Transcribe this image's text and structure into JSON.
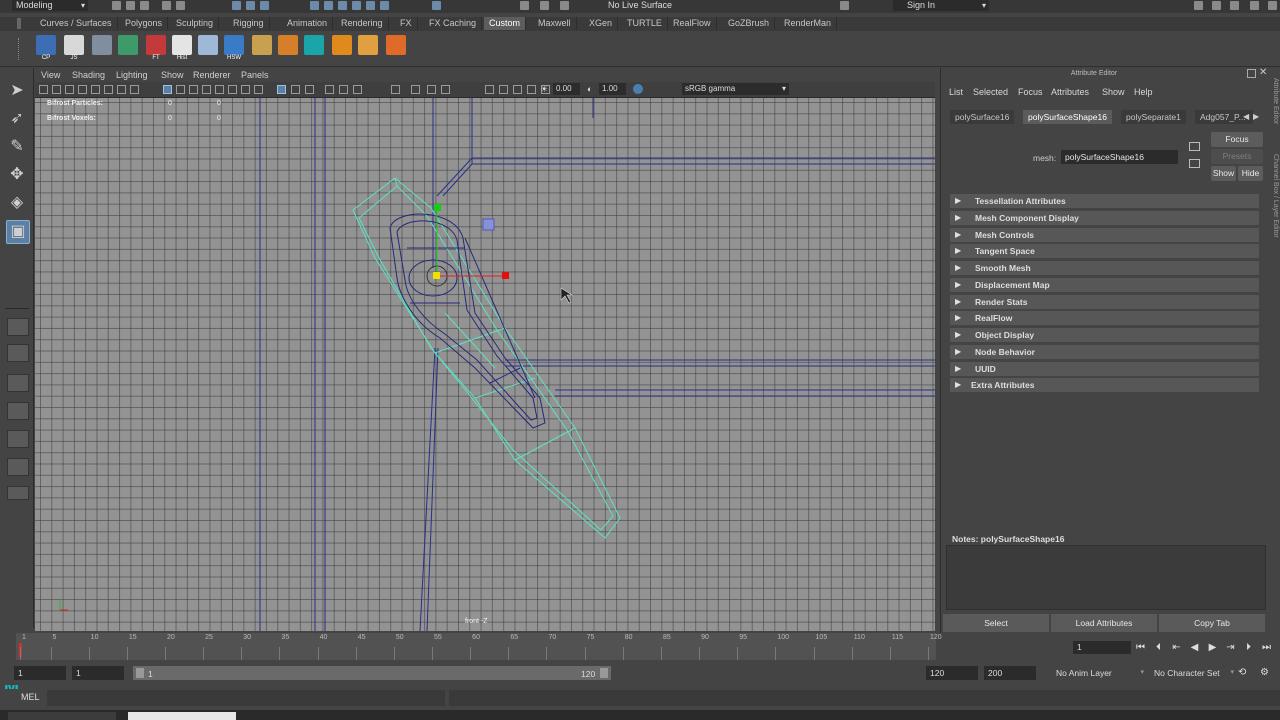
{
  "app": {
    "mode": "Modeling",
    "live_surface": "No Live Surface",
    "sign_in": "Sign In"
  },
  "shelf": {
    "tabs": [
      "Curves / Surfaces",
      "Polygons",
      "Sculpting",
      "Rigging",
      "Animation",
      "Rendering",
      "FX",
      "FX Caching",
      "Custom",
      "Maxwell",
      "XGen",
      "TURTLE",
      "RealFlow",
      "GoZBrush",
      "RenderMan"
    ],
    "active_tab": "Custom",
    "icons": [
      {
        "name": "cp",
        "label": "CP",
        "color": "#3d6db5"
      },
      {
        "name": "js",
        "label": "JS",
        "color": "#d8d8d8"
      },
      {
        "name": "joint-tool",
        "label": "",
        "color": "#7f8fa0"
      },
      {
        "name": "checker",
        "label": "",
        "color": "#3f9a6a"
      },
      {
        "name": "ft",
        "label": "FT",
        "color": "#c43a3a"
      },
      {
        "name": "hist",
        "label": "Hist",
        "color": "#e4e4e4"
      },
      {
        "name": "scatter",
        "label": "",
        "color": "#a0b8d8"
      },
      {
        "name": "hsw",
        "label": "HSW",
        "color": "#3a7bc8"
      },
      {
        "name": "pen",
        "label": "",
        "color": "#c8a050"
      },
      {
        "name": "box",
        "label": "",
        "color": "#d67e2a"
      },
      {
        "name": "teal",
        "label": "",
        "color": "#1aa6a8"
      },
      {
        "name": "gear",
        "label": "",
        "color": "#e08a1e"
      },
      {
        "name": "diamond",
        "label": "",
        "color": "#e0a040"
      },
      {
        "name": "cube-arrow",
        "label": "",
        "color": "#e06a2a"
      }
    ]
  },
  "viewport": {
    "menus": [
      "View",
      "Shading",
      "Lighting",
      "Show",
      "Renderer",
      "Panels"
    ],
    "exposure": "0.00",
    "gamma": "1.00",
    "color_space": "sRGB gamma",
    "hud": [
      {
        "label": "Bifrost Particles:",
        "a": "0",
        "b": "0"
      },
      {
        "label": "Bifrost Voxels:",
        "a": "0",
        "b": "0"
      }
    ],
    "camera": "front -Z"
  },
  "attribute_editor": {
    "title": "Attribute Editor",
    "menus": [
      "List",
      "Selected",
      "Focus",
      "Attributes",
      "Show",
      "Help"
    ],
    "tabs": [
      "polySurface16",
      "polySurfaceShape16",
      "polySeparate1",
      "Adg057_P..."
    ],
    "active_tab": "polySurfaceShape16",
    "focus_button": "Focus",
    "presets_button": "Presets",
    "show_button": "Show",
    "hide_button": "Hide",
    "mesh_label": "mesh:",
    "mesh_value": "polySurfaceShape16",
    "sections": [
      "Tessellation Attributes",
      "Mesh Component Display",
      "Mesh Controls",
      "Tangent Space",
      "Smooth Mesh",
      "Displacement Map",
      "Render Stats",
      "RealFlow",
      "Object Display",
      "Node Behavior",
      "UUID",
      "Extra Attributes"
    ],
    "notes_label": "Notes: polySurfaceShape16",
    "footer": [
      "Select",
      "Load Attributes",
      "Copy Tab"
    ],
    "side_labels": [
      "Attribute Editor",
      "Channel Box / Layer Editor"
    ]
  },
  "timeline": {
    "ticks": [
      "1",
      "5",
      "10",
      "15",
      "20",
      "25",
      "30",
      "35",
      "40",
      "45",
      "50",
      "55",
      "60",
      "65",
      "70",
      "75",
      "80",
      "85",
      "90",
      "95",
      "100",
      "105",
      "110",
      "115",
      "120"
    ],
    "current_frame": "1"
  },
  "range": {
    "start_field": "1",
    "start_inner": "1",
    "range_start_label": "1",
    "range_end_label": "120",
    "end_inner": "120",
    "end_field": "200",
    "anim_layer": "No Anim Layer",
    "character_set": "No Character Set"
  },
  "command_line": {
    "label": "MEL"
  }
}
